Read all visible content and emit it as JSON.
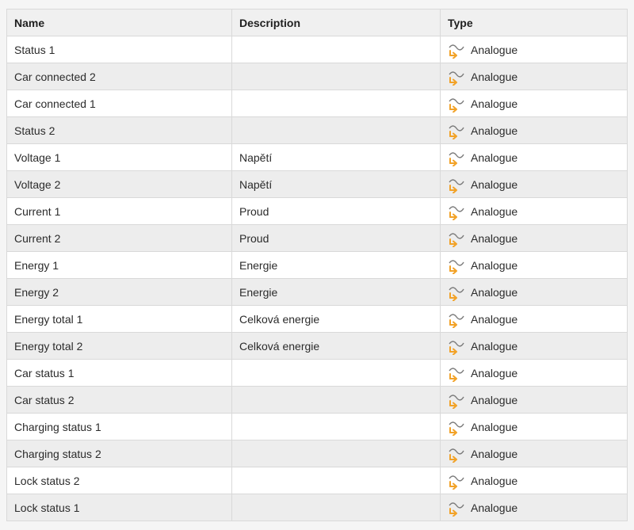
{
  "table": {
    "headers": {
      "name": "Name",
      "description": "Description",
      "type": "Type"
    },
    "rows": [
      {
        "name": "Status 1",
        "description": "",
        "type": "Analogue",
        "icon": "analogue-input-icon"
      },
      {
        "name": "Car connected 2",
        "description": "",
        "type": "Analogue",
        "icon": "analogue-input-icon"
      },
      {
        "name": "Car connected 1",
        "description": "",
        "type": "Analogue",
        "icon": "analogue-input-icon"
      },
      {
        "name": "Status 2",
        "description": "",
        "type": "Analogue",
        "icon": "analogue-input-icon"
      },
      {
        "name": "Voltage 1",
        "description": "Napětí",
        "type": "Analogue",
        "icon": "analogue-input-icon"
      },
      {
        "name": "Voltage 2",
        "description": "Napětí",
        "type": "Analogue",
        "icon": "analogue-input-icon"
      },
      {
        "name": "Current 1",
        "description": "Proud",
        "type": "Analogue",
        "icon": "analogue-input-icon"
      },
      {
        "name": "Current 2",
        "description": "Proud",
        "type": "Analogue",
        "icon": "analogue-input-icon"
      },
      {
        "name": "Energy 1",
        "description": "Energie",
        "type": "Analogue",
        "icon": "analogue-input-icon"
      },
      {
        "name": "Energy 2",
        "description": "Energie",
        "type": "Analogue",
        "icon": "analogue-input-icon"
      },
      {
        "name": "Energy total 1",
        "description": "Celková energie",
        "type": "Analogue",
        "icon": "analogue-input-icon"
      },
      {
        "name": "Energy total 2",
        "description": "Celková energie",
        "type": "Analogue",
        "icon": "analogue-input-icon"
      },
      {
        "name": "Car status 1",
        "description": "",
        "type": "Analogue",
        "icon": "analogue-input-icon"
      },
      {
        "name": "Car status 2",
        "description": "",
        "type": "Analogue",
        "icon": "analogue-input-icon"
      },
      {
        "name": "Charging status 1",
        "description": "",
        "type": "Analogue",
        "icon": "analogue-input-icon"
      },
      {
        "name": "Charging status 2",
        "description": "",
        "type": "Analogue",
        "icon": "analogue-input-icon"
      },
      {
        "name": "Lock status 2",
        "description": "",
        "type": "Analogue",
        "icon": "analogue-input-icon"
      },
      {
        "name": "Lock status 1",
        "description": "",
        "type": "Analogue",
        "icon": "analogue-input-icon"
      }
    ]
  },
  "colors": {
    "icon_wave": "#7a7a7a",
    "icon_arrow": "#f2a227"
  }
}
